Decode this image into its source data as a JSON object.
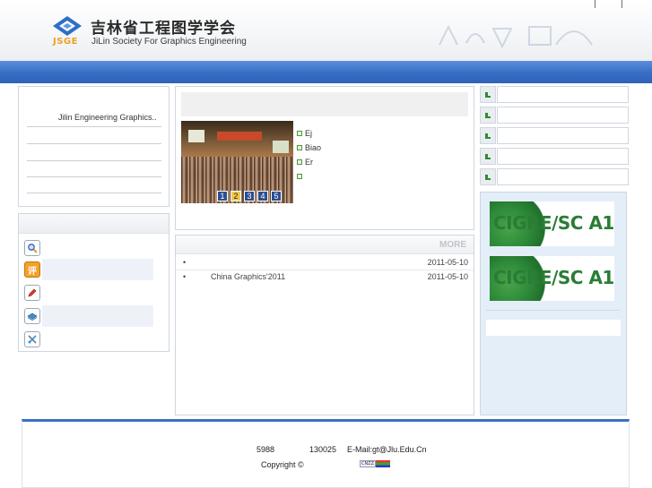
{
  "header": {
    "logo_abbr": "JSGE",
    "logo_cn": "吉林省工程图学学会",
    "logo_en": "JiLin Society For Graphics Engineering",
    "top_links": "| |"
  },
  "left_top": {
    "title": "Jilin Engineering Graphics.."
  },
  "left_bottom": {
    "items": [
      {
        "icon": "magnifier-icon"
      },
      {
        "icon": "review-icon",
        "glyph": "评"
      },
      {
        "icon": "pencil-icon"
      },
      {
        "icon": "book-icon"
      },
      {
        "icon": "tools-icon"
      }
    ]
  },
  "slideshow": {
    "pages": [
      "1",
      "2",
      "3",
      "4",
      "5"
    ],
    "active_page": "2",
    "captions": [
      "Ej",
      "Biao",
      "Er",
      ""
    ]
  },
  "news": {
    "more_label": "MORE",
    "rows": [
      {
        "bullet": "•",
        "title": "",
        "date": "2011-05-10"
      },
      {
        "bullet": "•",
        "title": "China Graphics'2011",
        "date": "2011-05-10"
      }
    ]
  },
  "right": {
    "banners": [
      {
        "text": "CIGRE/SC A1"
      },
      {
        "text": "CIGRE/SC A1"
      }
    ]
  },
  "footer": {
    "code": "5988",
    "postcode": "130025",
    "email": "E-Mail:gt@Jlu.Edu.Cn",
    "copyright": "Copyright ©",
    "counter_label": "CNZZ"
  },
  "colors": {
    "nav_blue": "#3a6fc6",
    "accent_green": "#2e8b2e",
    "logo_orange": "#f0a020",
    "right_panel_bg": "#e4eef8"
  }
}
